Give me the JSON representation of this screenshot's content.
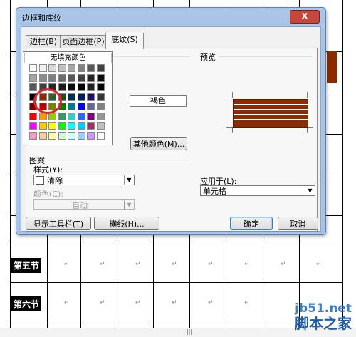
{
  "dialog": {
    "title": "边框和底纹",
    "close_label": "x",
    "tabs": [
      {
        "label": "边框(B)",
        "active": false
      },
      {
        "label": "页面边框(P)",
        "active": false
      },
      {
        "label": "底纹(S)",
        "active": true
      }
    ],
    "fill_group_label": "填充",
    "no_fill_label": "无填充颜色",
    "selected_color_name": "褐色",
    "more_colors_label": "其他颜色(M)...",
    "preview_label": "预览",
    "pattern_group_label": "图案",
    "style_label": "样式(Y):",
    "style_value": "清除",
    "color_label": "颜色(C):",
    "color_value": "自动",
    "apply_to_label": "应用于(L):",
    "apply_to_value": "单元格",
    "footer": {
      "show_toolbar_label": "显示工具栏(T)",
      "horizontal_line_label": "横线(H)...",
      "ok_label": "确定",
      "cancel_label": "取消"
    },
    "accent_color": "#8b2b00",
    "palette_rows": [
      [
        "#ffffff",
        "#f2f2f2",
        "#d9d9d9",
        "#bfbfbf",
        "#a6a6a6",
        "#808080",
        "#595959",
        "#404040"
      ],
      [
        "#a6a6a6",
        "#8c8c8c",
        "#7f7f7f",
        "#6b6b6b",
        "#595959",
        "#404040",
        "#262626",
        "#0d0d0d"
      ],
      [
        "#595959",
        "#404040",
        "#262626",
        "#1a1a1a",
        "#0d0d0d",
        "#000000",
        "#1f1f1f",
        "#000000"
      ],
      [
        "#000000",
        "#8b2b00",
        "#2f5f2f",
        "#1f4f1f",
        "#002f4f",
        "#002060",
        "#20105f",
        "#333333"
      ],
      [
        "#800000",
        "#c00000",
        "#808000",
        "#008000",
        "#008080",
        "#0000ff",
        "#666699",
        "#808080"
      ],
      [
        "#ff0000",
        "#ff9900",
        "#99cc00",
        "#339966",
        "#33cccc",
        "#3366ff",
        "#800080",
        "#969696"
      ],
      [
        "#ff00ff",
        "#ffcc00",
        "#ffff00",
        "#00ff00",
        "#00ffff",
        "#00ccff",
        "#993366",
        "#c0c0c0"
      ],
      [
        "#ff99cc",
        "#ffcc99",
        "#ffff99",
        "#ccffcc",
        "#ccffff",
        "#99ccff",
        "#cc99ff",
        "#ffffff"
      ]
    ]
  },
  "document": {
    "row_labels": [
      "第五节",
      "第六节"
    ]
  },
  "watermark": {
    "line1": "jb51.net",
    "line2": "脚本之家"
  }
}
